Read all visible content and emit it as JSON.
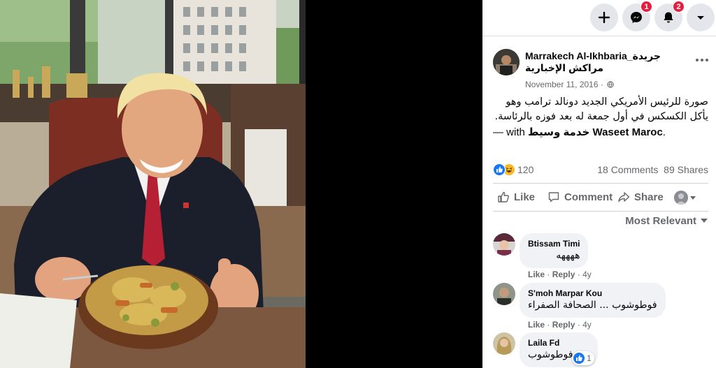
{
  "colors": {
    "accent": "#1877f2",
    "badge": "#e41e3f",
    "secondary_text": "#65676b",
    "bubble_bg": "#f0f2f5",
    "nav_button_bg": "#e4e6eb"
  },
  "topnav": {
    "create_icon": "plus-icon",
    "messenger_icon": "messenger-icon",
    "messenger_badge": "1",
    "notifications_icon": "bell-icon",
    "notifications_badge": "2",
    "account_icon": "caret-down-icon"
  },
  "post": {
    "page_name_line1": "Marrakech Al-Ikhbaria_جريدة",
    "page_name_line2": "مراكش الإخبارية",
    "date": "November 11, 2016",
    "date_separator": "·",
    "privacy_icon": "globe-icon",
    "more_icon": "more-icon",
    "text_arabic_line1": "صورة للرئيس الأمريكي الجديد دونالد ترامب وهو",
    "text_arabic_line2": "يأكل الكسكس في أول جمعة له بعد فوزه بالرئاسة.",
    "with_prefix": "— with",
    "tagged_page": "خدمة وسيط Waseet Maroc",
    "with_suffix": ".",
    "reaction_count": "120",
    "reaction_icons": [
      "like-icon",
      "haha-icon"
    ],
    "comments_count": "18 Comments",
    "shares_count": "89 Shares"
  },
  "actions": {
    "like": "Like",
    "comment": "Comment",
    "share": "Share"
  },
  "sort": {
    "label": "Most Relevant"
  },
  "comments": [
    {
      "name": "Btissam Timi",
      "text": "ههههه",
      "like": "Like",
      "reply": "Reply",
      "time": "4y"
    },
    {
      "name": "S'moh Marpar Kou",
      "text": "فوطوشوب ... الصحافة الصفراء",
      "like": "Like",
      "reply": "Reply",
      "time": "4y"
    },
    {
      "name": "Laila Fd",
      "text": "فوطوشوب",
      "reaction_count": "1"
    }
  ],
  "meta_separator": "·"
}
